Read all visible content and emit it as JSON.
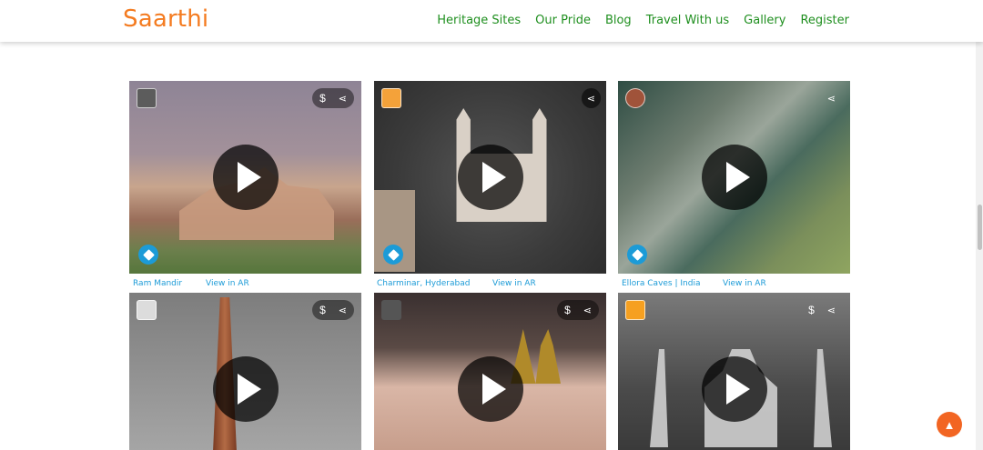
{
  "brand": "Saarthi",
  "nav": [
    "Heritage Sites",
    "Our Pride",
    "Blog",
    "Travel With us",
    "Gallery",
    "Register"
  ],
  "cards": [
    {
      "title": "Ram Mandir",
      "ar_label": "View in AR",
      "has_price": true,
      "has_ar": true
    },
    {
      "title": "Charminar, Hyderabad",
      "ar_label": "View in AR",
      "has_price": false,
      "has_ar": true
    },
    {
      "title": "Ellora Caves | India",
      "ar_label": "View in AR",
      "has_price": false,
      "has_ar": true
    },
    {
      "title": "",
      "ar_label": "",
      "has_price": true,
      "has_ar": false
    },
    {
      "title": "",
      "ar_label": "",
      "has_price": true,
      "has_ar": false
    },
    {
      "title": "",
      "ar_label": "",
      "has_price": true,
      "has_ar": false
    }
  ],
  "icons": {
    "price": "$",
    "share": "share-icon",
    "back_to_top": "arrow-up-icon"
  },
  "colors": {
    "brand": "#f47b20",
    "nav": "#1f8f1f",
    "link": "#1c9bd7",
    "back_top": "#f26522"
  }
}
